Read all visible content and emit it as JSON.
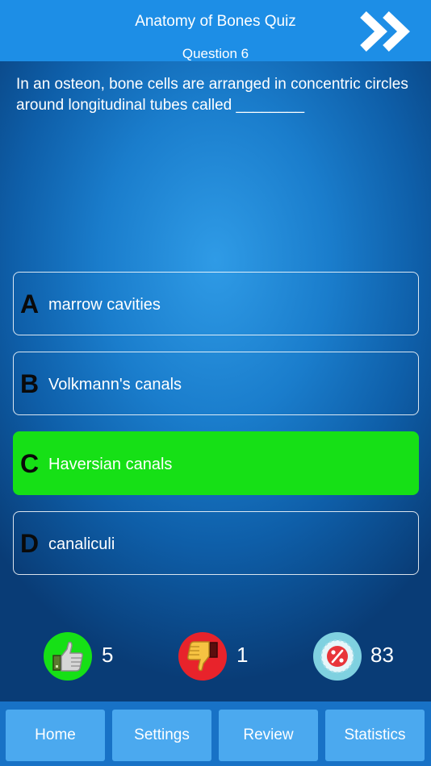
{
  "header": {
    "title": "Anatomy of Bones Quiz",
    "question_label": "Question 6",
    "next_icon": "double-chevron-right-icon"
  },
  "question": {
    "text": "In an osteon, bone cells are arranged in concentric circles around longitudinal tubes called ________"
  },
  "answers": [
    {
      "letter": "A",
      "label": "marrow cavities",
      "state": "default"
    },
    {
      "letter": "B",
      "label": "Volkmann's canals",
      "state": "default"
    },
    {
      "letter": "C",
      "label": "Haversian canals",
      "state": "correct"
    },
    {
      "letter": "D",
      "label": "canaliculi",
      "state": "default"
    }
  ],
  "stats": {
    "correct": {
      "icon": "thumbs-up-icon",
      "value": "5",
      "color": "#16e016"
    },
    "wrong": {
      "icon": "thumbs-down-icon",
      "value": "1",
      "color": "#e8232b"
    },
    "percent": {
      "icon": "percent-badge-icon",
      "value": "83",
      "color": "#7fd1e0"
    }
  },
  "tabbar": {
    "home": "Home",
    "settings": "Settings",
    "review": "Review",
    "statistics": "Statistics"
  },
  "colors": {
    "header_bg": "#1d8ee6",
    "correct_answer_bg": "#16e016",
    "tab_bg": "#4ba9ef",
    "tabbar_bg": "#1872c6"
  }
}
